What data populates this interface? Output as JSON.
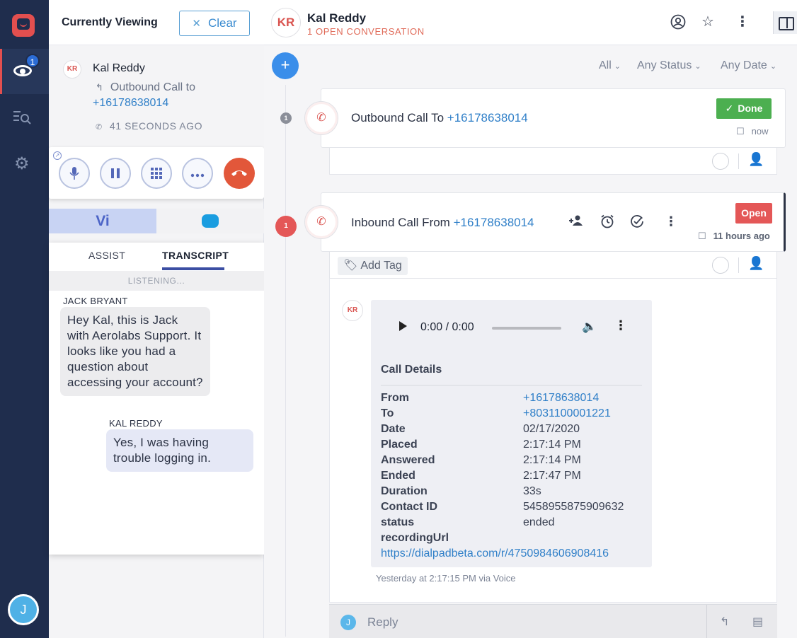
{
  "rail": {
    "badge_count": "1",
    "user_initial": "J"
  },
  "sidebar": {
    "title": "Currently Viewing",
    "clear_label": "Clear",
    "card": {
      "avatar": "KR",
      "name": "Kal Reddy",
      "sub": "Outbound Call to",
      "phone": "+16178638014",
      "ago": "41 SECONDS AGO"
    }
  },
  "vi_tab": "Vi",
  "transcript_panel": {
    "tab_assist": "ASSIST",
    "tab_transcript": "TRANSCRIPT",
    "status": "LISTENING...",
    "messages": [
      {
        "speaker": "JACK BRYANT",
        "text": "Hey Kal, this is Jack with Aerolabs Support. It looks like you had a question about accessing your account?"
      },
      {
        "speaker": "KAL REDDY",
        "text": "Yes, I was having trouble logging in."
      }
    ]
  },
  "header": {
    "avatar": "KR",
    "name": "Kal Reddy",
    "subtitle": "1 OPEN CONVERSATION"
  },
  "filters": {
    "all": "All",
    "status": "Any Status",
    "date": "Any Date"
  },
  "conversations": [
    {
      "step": "1",
      "title_prefix": "Outbound Call To ",
      "phone": "+16178638014",
      "status": "Done",
      "time": "now"
    },
    {
      "step": "1",
      "title_prefix": "Inbound Call From ",
      "phone": "+16178638014",
      "status": "Open",
      "time": "11 hours ago",
      "add_tag": "Add Tag"
    }
  ],
  "message": {
    "avatar": "KR",
    "audio_time": "0:00 / 0:00",
    "details_title": "Call Details",
    "details": {
      "from_label": "From",
      "from": "+16178638014",
      "to_label": "To",
      "to": "+8031100001221",
      "date_label": "Date",
      "date": "02/17/2020",
      "placed_label": "Placed",
      "placed": "2:17:14 PM",
      "answered_label": "Answered",
      "answered": "2:17:14 PM",
      "ended_label": "Ended",
      "ended": "2:17:47 PM",
      "duration_label": "Duration",
      "duration": "33s",
      "contact_label": "Contact ID",
      "contact": "5458955875909632",
      "status_label": "status",
      "status": "ended",
      "recording_label": "recordingUrl",
      "recording_url": "https://dialpadbeta.com/r/4750984606908416"
    },
    "footer": "Yesterday at 2:17:15 PM via Voice"
  },
  "reply": {
    "avatar": "J",
    "placeholder": "Reply"
  },
  "colors": {
    "rail": "#1f2d4d",
    "accent_blue": "#3a8eea",
    "done_green": "#4caf50",
    "open_red": "#e45757",
    "hangup": "#e2573a"
  }
}
